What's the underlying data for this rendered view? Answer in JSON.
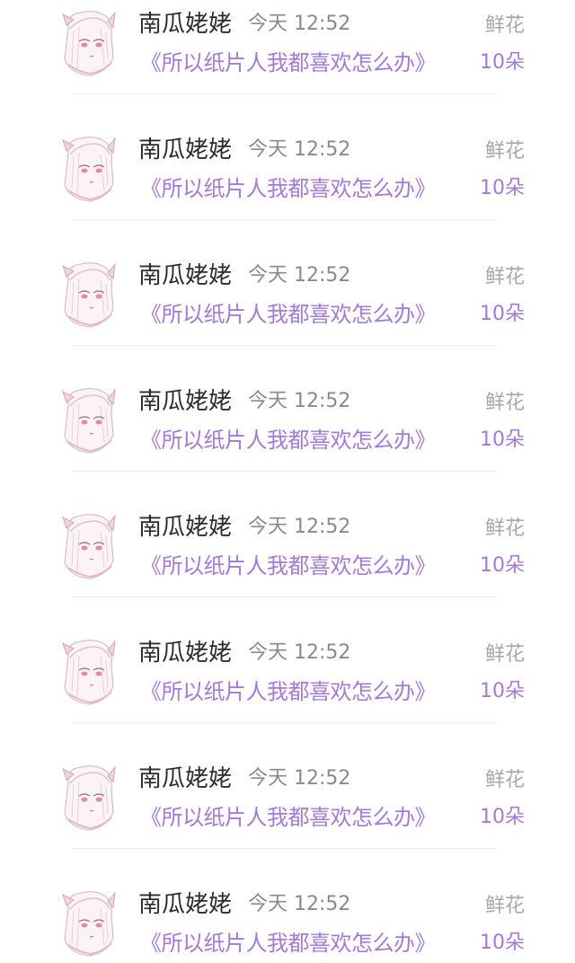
{
  "colors": {
    "name": "#2c2c2c",
    "time": "#8a8a8a",
    "accent": "#a57ad6",
    "gift_type": "#a8a8a8",
    "divider": "#f0eef2"
  },
  "icons": {
    "avatar": "anime-avatar-icon"
  },
  "records": [
    {
      "user": "南瓜姥姥",
      "time": "今天 12:52",
      "book": "《所以纸片人我都喜欢怎么办》",
      "gift_type": "鲜花",
      "gift_count": "10朵"
    },
    {
      "user": "南瓜姥姥",
      "time": "今天 12:52",
      "book": "《所以纸片人我都喜欢怎么办》",
      "gift_type": "鲜花",
      "gift_count": "10朵"
    },
    {
      "user": "南瓜姥姥",
      "time": "今天 12:52",
      "book": "《所以纸片人我都喜欢怎么办》",
      "gift_type": "鲜花",
      "gift_count": "10朵"
    },
    {
      "user": "南瓜姥姥",
      "time": "今天 12:52",
      "book": "《所以纸片人我都喜欢怎么办》",
      "gift_type": "鲜花",
      "gift_count": "10朵"
    },
    {
      "user": "南瓜姥姥",
      "time": "今天 12:52",
      "book": "《所以纸片人我都喜欢怎么办》",
      "gift_type": "鲜花",
      "gift_count": "10朵"
    },
    {
      "user": "南瓜姥姥",
      "time": "今天 12:52",
      "book": "《所以纸片人我都喜欢怎么办》",
      "gift_type": "鲜花",
      "gift_count": "10朵"
    },
    {
      "user": "南瓜姥姥",
      "time": "今天 12:52",
      "book": "《所以纸片人我都喜欢怎么办》",
      "gift_type": "鲜花",
      "gift_count": "10朵"
    },
    {
      "user": "南瓜姥姥",
      "time": "今天 12:52",
      "book": "《所以纸片人我都喜欢怎么办》",
      "gift_type": "鲜花",
      "gift_count": "10朵"
    }
  ]
}
